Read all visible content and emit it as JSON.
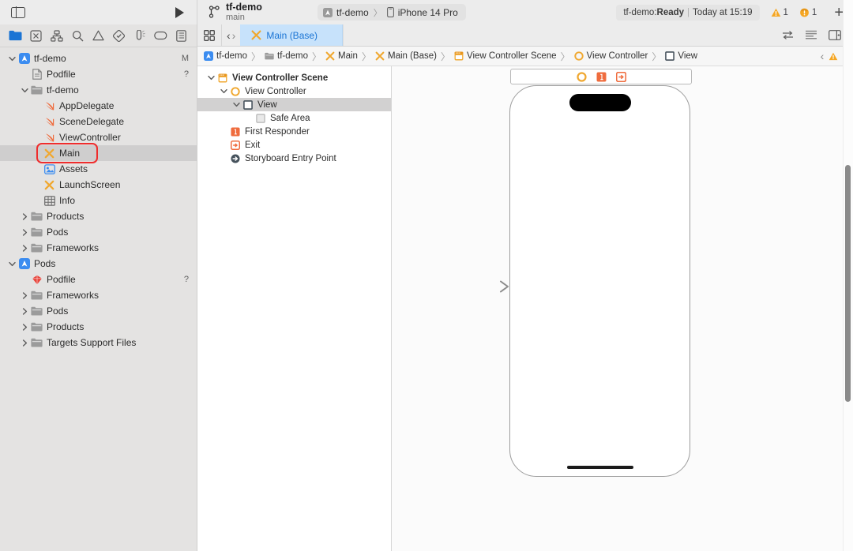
{
  "toolbar": {
    "sidebar_toggle_name": "sidebar-toggle-icon",
    "run_button_label": "Run",
    "scheme": {
      "name": "tf-demo",
      "branch": "main"
    },
    "destination": {
      "project": "tf-demo",
      "device": "iPhone 14 Pro",
      "separator": "〉"
    },
    "status": {
      "prefix": "tf-demo: ",
      "state": "Ready",
      "divider": "|",
      "time": "Today at 15:19"
    },
    "badges": [
      {
        "icon": "warning-triangle-icon",
        "count": "1",
        "color": "#f5a623"
      },
      {
        "icon": "warning-circle-icon",
        "count": "1",
        "color": "#f5a623"
      }
    ],
    "add_button_label": "+"
  },
  "navigator": {
    "filter_icons": [
      "folder-icon",
      "issue-navigator-icon",
      "hierarchy-icon",
      "search-icon",
      "warning-icon",
      "test-icon",
      "debug-icon",
      "breakpoint-icon",
      "report-icon"
    ],
    "active_filter": "folder-icon",
    "items": [
      {
        "label": "tf-demo",
        "icon": "xcode-project-icon",
        "depth": 0,
        "twisty": "open",
        "status": "M"
      },
      {
        "label": "Podfile",
        "icon": "file-icon",
        "depth": 1,
        "twisty": "none",
        "status": "?"
      },
      {
        "label": "tf-demo",
        "icon": "folder-icon",
        "depth": 1,
        "twisty": "open",
        "status": ""
      },
      {
        "label": "AppDelegate",
        "icon": "swift-icon",
        "depth": 2,
        "twisty": "none",
        "status": ""
      },
      {
        "label": "SceneDelegate",
        "icon": "swift-icon",
        "depth": 2,
        "twisty": "none",
        "status": ""
      },
      {
        "label": "ViewController",
        "icon": "swift-icon",
        "depth": 2,
        "twisty": "none",
        "status": ""
      },
      {
        "label": "Main",
        "icon": "storyboard-icon",
        "depth": 2,
        "twisty": "none",
        "status": "",
        "selected": true,
        "annotated": true
      },
      {
        "label": "Assets",
        "icon": "assets-icon",
        "depth": 2,
        "twisty": "none",
        "status": ""
      },
      {
        "label": "LaunchScreen",
        "icon": "storyboard-icon",
        "depth": 2,
        "twisty": "none",
        "status": ""
      },
      {
        "label": "Info",
        "icon": "plist-icon",
        "depth": 2,
        "twisty": "none",
        "status": ""
      },
      {
        "label": "Products",
        "icon": "folder-icon",
        "depth": 1,
        "twisty": "closed",
        "status": ""
      },
      {
        "label": "Pods",
        "icon": "folder-icon",
        "depth": 1,
        "twisty": "closed",
        "status": ""
      },
      {
        "label": "Frameworks",
        "icon": "folder-icon",
        "depth": 1,
        "twisty": "closed",
        "status": ""
      },
      {
        "label": "Pods",
        "icon": "xcode-project-icon",
        "depth": 0,
        "twisty": "open",
        "status": ""
      },
      {
        "label": "Podfile",
        "icon": "ruby-icon",
        "depth": 1,
        "twisty": "none",
        "status": "?"
      },
      {
        "label": "Frameworks",
        "icon": "folder-icon",
        "depth": 1,
        "twisty": "closed",
        "status": ""
      },
      {
        "label": "Pods",
        "icon": "folder-icon",
        "depth": 1,
        "twisty": "closed",
        "status": ""
      },
      {
        "label": "Products",
        "icon": "folder-icon",
        "depth": 1,
        "twisty": "closed",
        "status": ""
      },
      {
        "label": "Targets Support Files",
        "icon": "folder-icon",
        "depth": 1,
        "twisty": "closed",
        "status": ""
      }
    ]
  },
  "editor": {
    "tabbar": {
      "grid_icon": "tab-overview-icon",
      "back_label": "‹",
      "forward_label": "›",
      "tab": {
        "label": "Main (Base)",
        "icon": "storyboard-icon"
      },
      "right_icons": [
        "adjust-editor-icon",
        "editor-options-icon",
        "inspector-toggle-icon"
      ]
    },
    "breadcrumb": [
      {
        "label": "tf-demo",
        "icon": "xcode-project-icon"
      },
      {
        "label": "tf-demo",
        "icon": "folder-icon"
      },
      {
        "label": "Main",
        "icon": "storyboard-icon"
      },
      {
        "label": "Main (Base)",
        "icon": "storyboard-icon"
      },
      {
        "label": "View Controller Scene",
        "icon": "scene-icon"
      },
      {
        "label": "View Controller",
        "icon": "view-controller-icon"
      },
      {
        "label": "View",
        "icon": "view-icon"
      }
    ],
    "breadcrumb_separator": "〉",
    "jump_right": {
      "prev_label": "‹",
      "warning_icon": "warning-triangle-icon",
      "next_label": "›"
    },
    "outline": [
      {
        "label": "View Controller Scene",
        "icon": "scene-icon",
        "depth": 0,
        "twisty": "open",
        "bold": true
      },
      {
        "label": "View Controller",
        "icon": "view-controller-icon",
        "depth": 1,
        "twisty": "open"
      },
      {
        "label": "View",
        "icon": "view-icon",
        "depth": 2,
        "twisty": "open",
        "selected": true
      },
      {
        "label": "Safe Area",
        "icon": "safe-area-icon",
        "depth": 3,
        "twisty": "none"
      },
      {
        "label": "First Responder",
        "icon": "first-responder-icon",
        "depth": 1,
        "twisty": "none"
      },
      {
        "label": "Exit",
        "icon": "exit-icon",
        "depth": 1,
        "twisty": "none"
      },
      {
        "label": "Storyboard Entry Point",
        "icon": "entry-point-icon",
        "depth": 1,
        "twisty": "none"
      }
    ],
    "canvas": {
      "scene_dock_icons": [
        "view-controller-icon",
        "first-responder-icon",
        "exit-icon"
      ],
      "device_name": "iPhone 14 Pro",
      "entry_arrow_name": "storyboard-entry-arrow"
    }
  },
  "colors": {
    "accent_blue": "#1a74d4",
    "tab_bg": "#c7e2fb",
    "warning_orange": "#f5a623",
    "annotation_red": "#ef2d2d",
    "swift_orange": "#ef6c3e",
    "storyboard_yellow": "#f0a830"
  }
}
